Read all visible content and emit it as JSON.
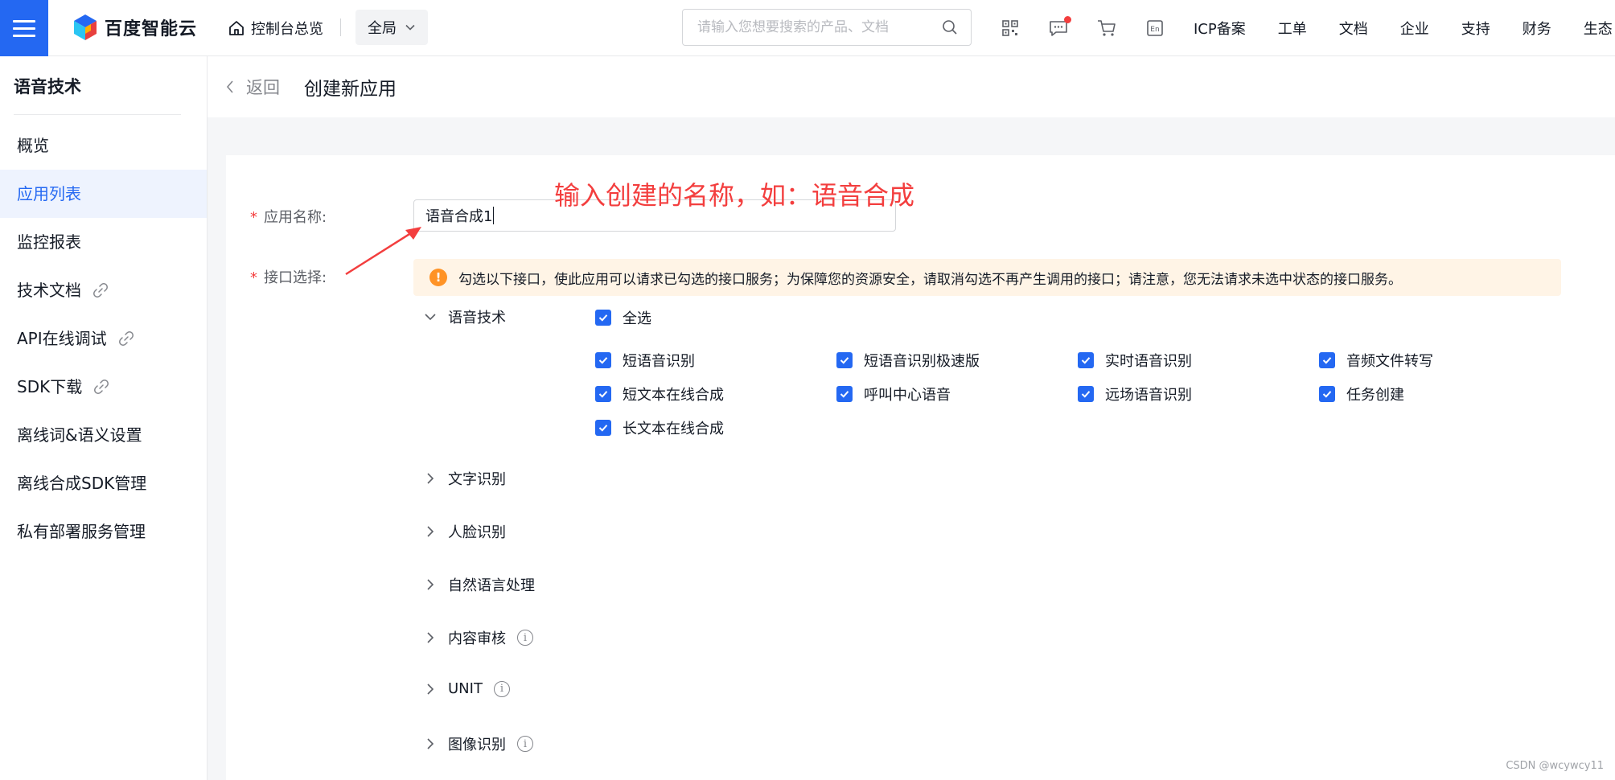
{
  "topbar": {
    "logo_text": "百度智能云",
    "console_label": "控制台总览",
    "region_label": "全局",
    "search_placeholder": "请输入您想要搜索的产品、文档",
    "icons": [
      "qrcode-icon",
      "message-icon",
      "cart-icon",
      "language-en-icon"
    ],
    "nav": [
      "ICP备案",
      "工单",
      "文档",
      "企业",
      "支持",
      "财务",
      "生态"
    ],
    "brand_color": "#2468f2"
  },
  "sidebar": {
    "title": "语音技术",
    "items": [
      {
        "label": "概览",
        "active": false,
        "external": false
      },
      {
        "label": "应用列表",
        "active": true,
        "external": false
      },
      {
        "label": "监控报表",
        "active": false,
        "external": false
      },
      {
        "label": "技术文档",
        "active": false,
        "external": true
      },
      {
        "label": "API在线调试",
        "active": false,
        "external": true
      },
      {
        "label": "SDK下载",
        "active": false,
        "external": true
      },
      {
        "label": "离线词&语义设置",
        "active": false,
        "external": false
      },
      {
        "label": "离线合成SDK管理",
        "active": false,
        "external": false
      },
      {
        "label": "私有部署服务管理",
        "active": false,
        "external": false
      }
    ]
  },
  "header": {
    "back_label": "返回",
    "title": "创建新应用"
  },
  "form": {
    "name_label": "应用名称:",
    "name_value": "语音合成1",
    "api_label": "接口选择:",
    "alert_text": "勾选以下接口，使此应用可以请求已勾选的接口服务；为保障您的资源安全，请取消勾选不再产生调用的接口；请注意，您无法请求未选中状态的接口服务。",
    "groups": [
      {
        "label": "语音技术",
        "expanded": true,
        "info": false
      },
      {
        "label": "文字识别",
        "expanded": false,
        "info": false
      },
      {
        "label": "人脸识别",
        "expanded": false,
        "info": false
      },
      {
        "label": "自然语言处理",
        "expanded": false,
        "info": false
      },
      {
        "label": "内容审核",
        "expanded": false,
        "info": true
      },
      {
        "label": "UNIT",
        "expanded": false,
        "info": true
      },
      {
        "label": "图像识别",
        "expanded": false,
        "info": true
      }
    ],
    "select_all_label": "全选",
    "checkboxes": [
      {
        "label": "短语音识别",
        "checked": true
      },
      {
        "label": "短语音识别极速版",
        "checked": true
      },
      {
        "label": "实时语音识别",
        "checked": true
      },
      {
        "label": "音频文件转写",
        "checked": true
      },
      {
        "label": "短文本在线合成",
        "checked": true
      },
      {
        "label": "呼叫中心语音",
        "checked": true
      },
      {
        "label": "远场语音识别",
        "checked": true
      },
      {
        "label": "任务创建",
        "checked": true
      },
      {
        "label": "长文本在线合成",
        "checked": true
      }
    ]
  },
  "annotation": {
    "text": "输入创建的名称，如：语音合成",
    "color": "#f33e3e"
  },
  "watermark": "CSDN @wcywcy11"
}
